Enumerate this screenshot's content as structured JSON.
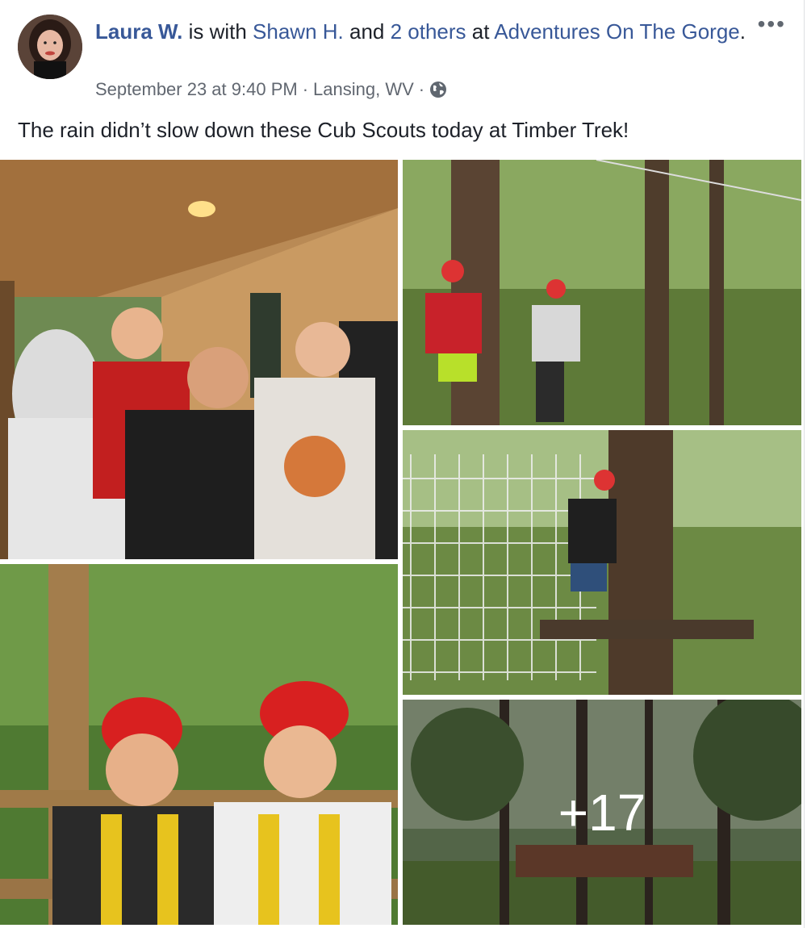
{
  "post": {
    "author": "Laura W.",
    "with_text": " is with ",
    "tagged_person": "Shawn H.",
    "and_text": " and ",
    "others": "2 others",
    "at_text": " at ",
    "place": "Adventures On The Gorge",
    "period": ".",
    "date": "September 23 at 9:40 PM",
    "sep1": "·",
    "location": "Lansing, WV",
    "sep2": "·",
    "privacy_icon": "globe-icon",
    "more_icon": "more-options-icon",
    "more_glyph": "•••",
    "text": "The rain didn’t slow down these Cub Scouts today at Timber Trek!"
  },
  "photos": {
    "more_count": "+17"
  },
  "colors": {
    "link": "#385898",
    "meta": "#616770",
    "text": "#1d2129"
  }
}
